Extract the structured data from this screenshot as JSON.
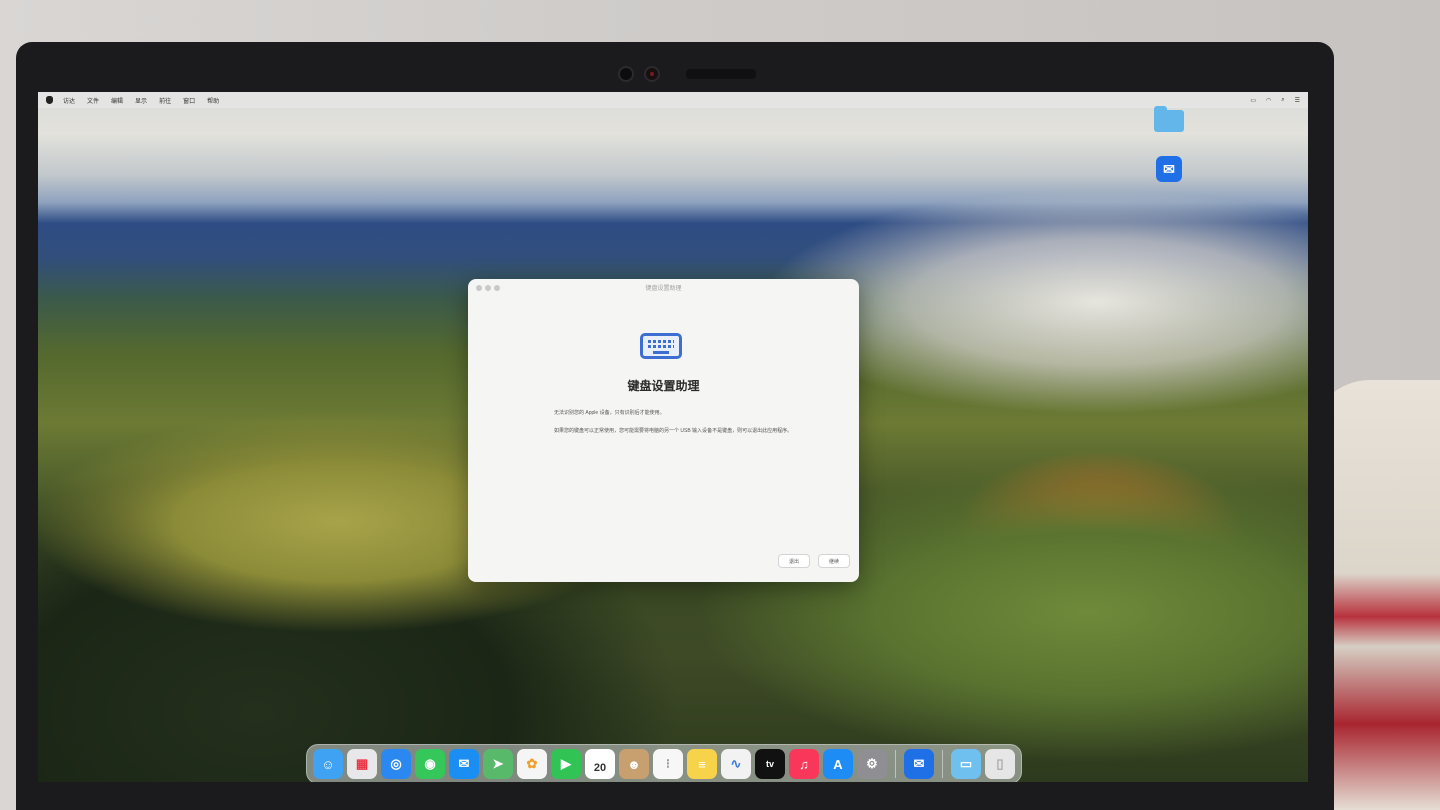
{
  "menubar": {
    "items": [
      "访达",
      "文件",
      "编辑",
      "显示",
      "前往",
      "窗口",
      "帮助"
    ]
  },
  "desktop": {
    "icons": [
      {
        "name": "folder",
        "label": ""
      },
      {
        "name": "zoom",
        "label": ""
      }
    ]
  },
  "dialog": {
    "window_title": "键盘设置助理",
    "heading": "键盘设置助理",
    "paragraph1": "无法识别您的 Apple 设备，只有识别后才能使用。",
    "paragraph2": "如果您的键盘可以正常使用，您可能需要将电脑的另一个 USB 输入设备不是键盘，则可以退出此应用程序。",
    "back_label": "退出",
    "continue_label": "继续"
  },
  "dock": {
    "calendar_day": "20",
    "apps": [
      {
        "name": "finder",
        "icon": "finder-icon",
        "color": "#3fa2f2"
      },
      {
        "name": "launchpad",
        "icon": "launchpad-icon",
        "color": "#e8e8ea"
      },
      {
        "name": "safari",
        "icon": "safari-icon",
        "color": "#2b88f0"
      },
      {
        "name": "messages",
        "icon": "messages-icon",
        "color": "#35c759"
      },
      {
        "name": "mail",
        "icon": "mail-icon",
        "color": "#1b8ef3"
      },
      {
        "name": "maps",
        "icon": "maps-icon",
        "color": "#58b96a"
      },
      {
        "name": "photos",
        "icon": "photos-icon",
        "color": "#f5f5f5"
      },
      {
        "name": "facetime",
        "icon": "facetime-icon",
        "color": "#31c455"
      },
      {
        "name": "calendar",
        "icon": "calendar-icon",
        "color": "#ffffff"
      },
      {
        "name": "contacts",
        "icon": "contacts-icon",
        "color": "#c8a070"
      },
      {
        "name": "reminders",
        "icon": "reminders-icon",
        "color": "#f7f7f7"
      },
      {
        "name": "notes",
        "icon": "notes-icon",
        "color": "#f7d34a"
      },
      {
        "name": "freeform",
        "icon": "freeform-icon",
        "color": "#f2f2f2"
      },
      {
        "name": "apple-tv",
        "icon": "apple-tv-icon",
        "color": "#111111"
      },
      {
        "name": "music",
        "icon": "music-icon",
        "color": "#f8375a"
      },
      {
        "name": "app-store",
        "icon": "app-store-icon",
        "color": "#1d8cf5"
      },
      {
        "name": "system-settings",
        "icon": "gear-icon",
        "color": "#8e8e93"
      },
      {
        "name": "zoom",
        "icon": "zoom-icon",
        "color": "#1f6fe6"
      },
      {
        "name": "downloads-folder",
        "icon": "folder-icon",
        "color": "#6fc0ef"
      },
      {
        "name": "trash",
        "icon": "trash-icon",
        "color": "#e6e6e6"
      }
    ]
  }
}
